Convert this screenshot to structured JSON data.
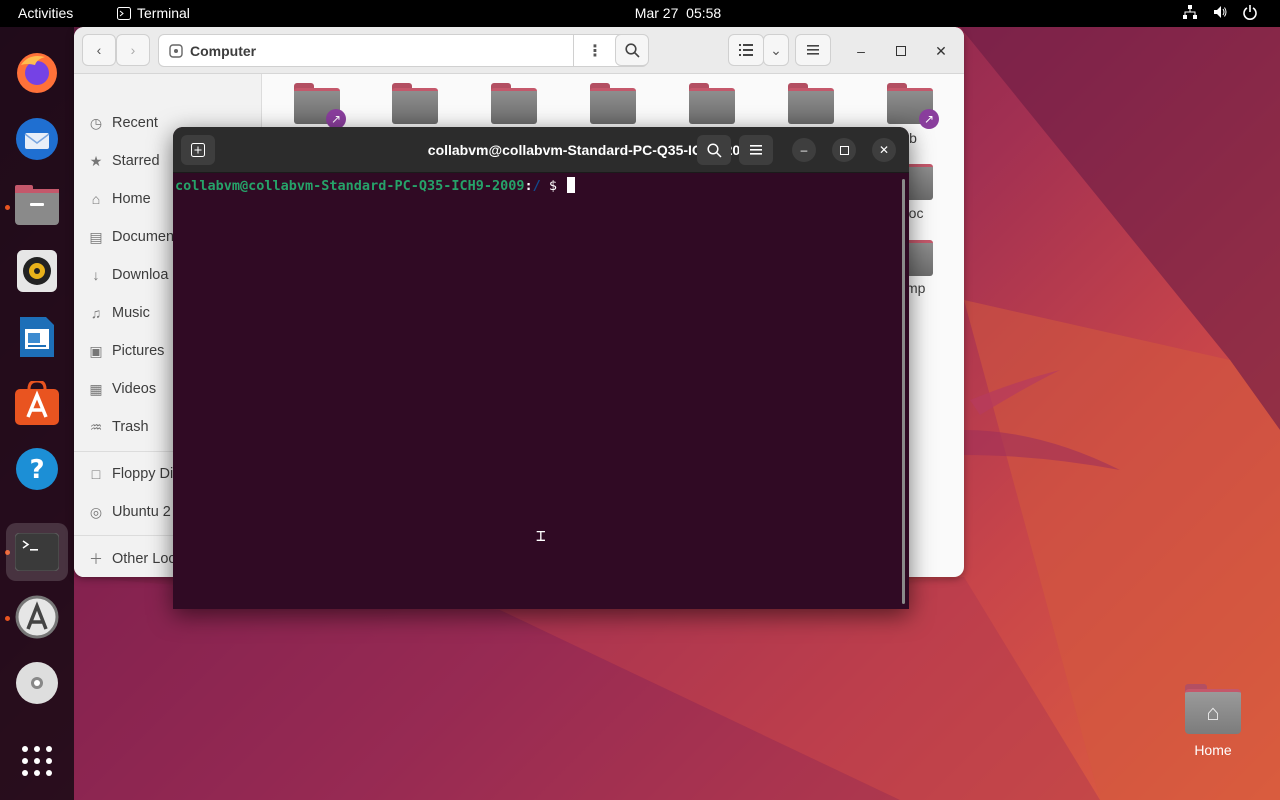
{
  "topbar": {
    "activities": "Activities",
    "app_name": "Terminal",
    "date": "Mar 27",
    "time": "05:58"
  },
  "dock": {
    "items": [
      {
        "name": "firefox",
        "icon": "firefox-icon"
      },
      {
        "name": "thunderbird",
        "icon": "thunderbird-icon"
      },
      {
        "name": "files",
        "icon": "files-icon"
      },
      {
        "name": "rhythmbox",
        "icon": "rhythmbox-icon"
      },
      {
        "name": "writer",
        "icon": "writer-icon"
      },
      {
        "name": "app-center",
        "icon": "app-center-icon"
      },
      {
        "name": "help",
        "icon": "help-icon"
      },
      {
        "name": "terminal",
        "icon": "terminal-icon"
      },
      {
        "name": "software-updater",
        "icon": "updater-icon"
      },
      {
        "name": "disc",
        "icon": "disc-icon"
      },
      {
        "name": "show-apps",
        "icon": "grid-icon"
      }
    ]
  },
  "files": {
    "location": "Computer",
    "sidebar": {
      "recent": "Recent",
      "starred": "Starred",
      "home": "Home",
      "documents": "Documen",
      "downloads": "Downloa",
      "music": "Music",
      "pictures": "Pictures",
      "videos": "Videos",
      "trash": "Trash",
      "floppy": "Floppy Di",
      "ubuntu": "Ubuntu 2",
      "other": "Other Loc"
    },
    "partial_names": {
      "lib": "ib",
      "proc": "roc",
      "tmp": "mp"
    }
  },
  "terminal": {
    "title": "collabvm@collabvm-Standard-PC-Q35-ICH9-2009: /",
    "prompt_user": "collabvm@collabvm-Standard-PC-Q35-ICH9-2009",
    "prompt_sep": ":",
    "prompt_path": "/",
    "prompt_symbol": "$"
  },
  "desktop": {
    "home_label": "Home"
  },
  "colors": {
    "terminal_bg": "#300a24",
    "accent": "#e95420",
    "prompt_user": "#26a269",
    "prompt_path": "#12488b"
  }
}
